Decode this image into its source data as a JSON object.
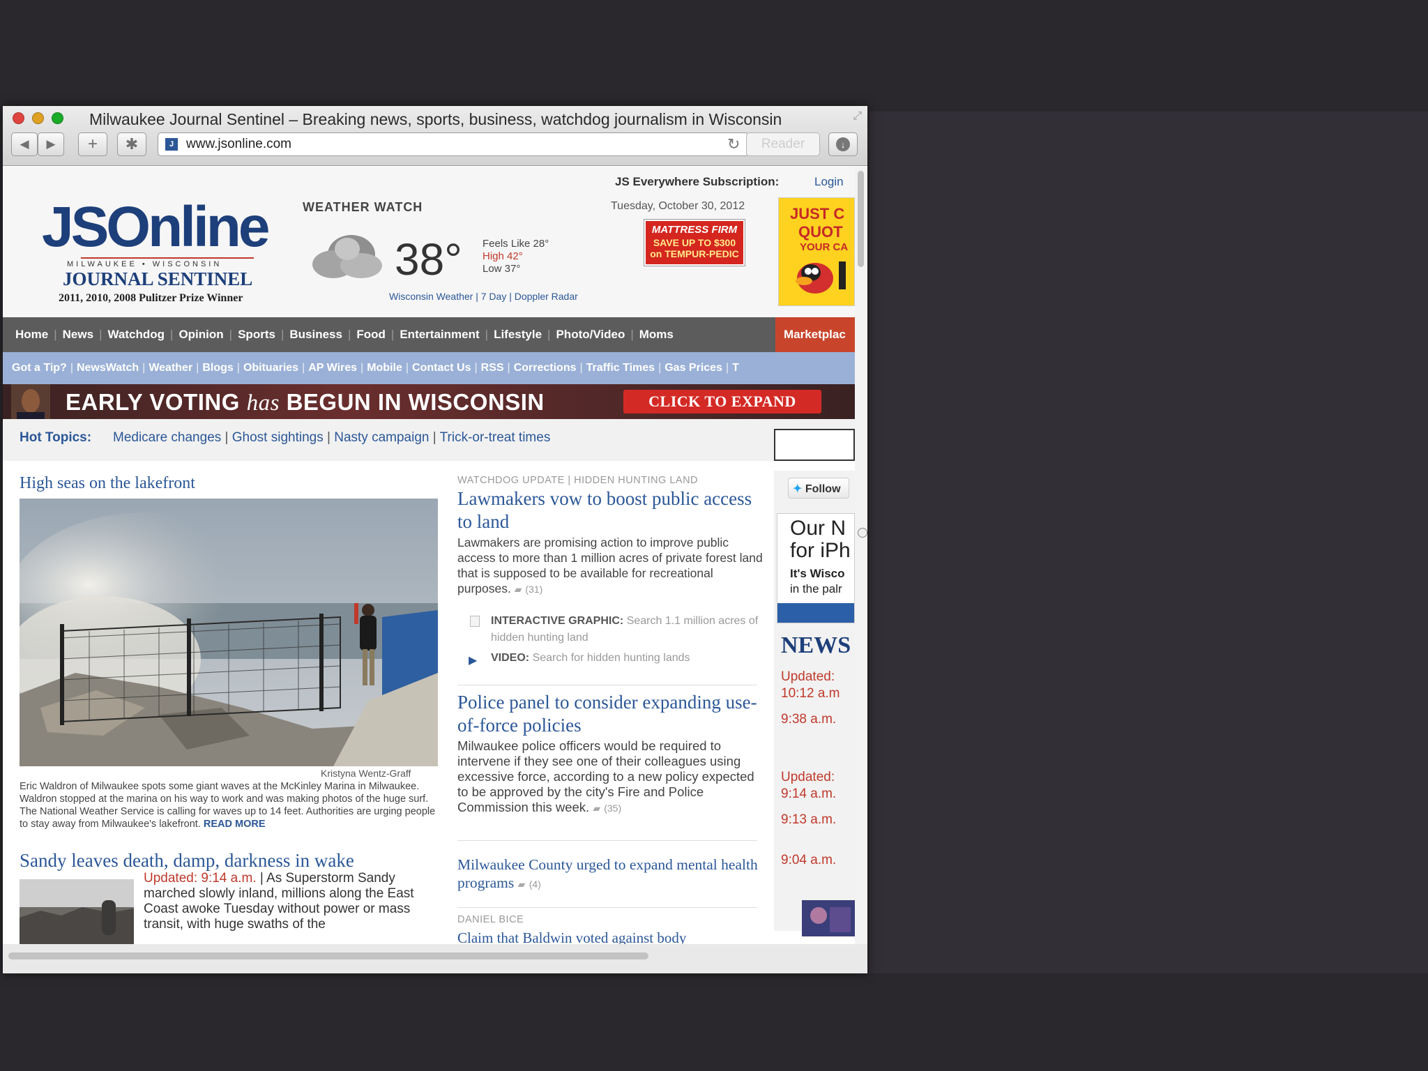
{
  "window": {
    "title": "Milwaukee Journal Sentinel – Breaking news, sports, business, watchdog journalism in Wisconsin",
    "url": "www.jsonline.com",
    "reader_label": "Reader"
  },
  "site": {
    "subscription_label": "JS Everywhere Subscription:",
    "login_label": "Login",
    "logo_main": "JSOnline",
    "logo_sub": "MILWAUKEE • WISCONSIN",
    "logo_paper": "JOURNAL SENTINEL",
    "pulitzer": "2011, 2010, 2008 Pulitzer Prize Winner",
    "date": "Tuesday, October 30, 2012"
  },
  "weather": {
    "heading": "WEATHER WATCH",
    "temp": "38°",
    "feels_like": "Feels Like 28°",
    "high": "High 42°",
    "low": "Low 37°",
    "links": "Wisconsin Weather | 7 Day | Doppler Radar"
  },
  "ads": {
    "mattress_brand": "MATTRESS FIRM",
    "mattress_line1": "SAVE UP TO $300",
    "mattress_line2": "on TEMPUR-PEDIC",
    "side_line1": "JUST C",
    "side_line2": "QUOT",
    "side_line3": "YOUR CA",
    "iphone_line1": "Our N",
    "iphone_line2": "for iPh",
    "iphone_line3": "It's Wisco",
    "iphone_line4": "in the palr"
  },
  "nav": {
    "items": [
      "Home",
      "News",
      "Watchdog",
      "Opinion",
      "Sports",
      "Business",
      "Food",
      "Entertainment",
      "Lifestyle",
      "Photo/Video",
      "Moms"
    ],
    "marketplace": "Marketplac"
  },
  "subnav": {
    "items": [
      "Got a Tip?",
      "NewsWatch",
      "Weather",
      "Blogs",
      "Obituaries",
      "AP Wires",
      "Mobile",
      "Contact Us",
      "RSS",
      "Corrections",
      "Traffic Times",
      "Gas Prices",
      "T"
    ]
  },
  "banner": {
    "text_a": "EARLY VOTING ",
    "text_has": "has",
    "text_b": " BEGUN IN WISCONSIN",
    "cta": "CLICK TO EXPAND"
  },
  "hot_topics": {
    "label": "Hot Topics:",
    "items": [
      "Medicare changes",
      "Ghost sightings",
      "Nasty campaign",
      "Trick-or-treat times"
    ]
  },
  "lead": {
    "heading": "High seas on the lakefront",
    "credit": "Kristyna Wentz-Graff",
    "caption": "Eric Waldron of Milwaukee spots some giant waves at the McKinley Marina in Milwaukee. Waldron stopped at the marina on his way to work and was making photos of the huge surf. The National Weather Service is calling for waves up to 14 feet. Authorities are urging people to stay away from Milwaukee's lakefront.",
    "read_more": "READ MORE"
  },
  "story2": {
    "headline": "Sandy leaves death, damp, darkness in wake",
    "updated": "Updated: 9:14 a.m.",
    "body": " | As Superstorm Sandy marched slowly inland, millions along the East Coast awoke Tuesday without power or mass transit, with huge swaths of the"
  },
  "middle": {
    "kicker": "WATCHDOG UPDATE | HIDDEN HUNTING LAND",
    "s1_headline": "Lawmakers vow to boost public access to land",
    "s1_body": "Lawmakers are promising action to improve public access to more than 1 million acres of private forest land that is supposed to be available for recreational purposes.",
    "s1_comments": "(31)",
    "graphic_label": "INTERACTIVE GRAPHIC:",
    "graphic_text": "Search 1.1 million acres of hidden hunting land",
    "video_label": "VIDEO:",
    "video_text": "Search for hidden hunting lands",
    "s2_headline": "Police panel to consider expanding use-of-force policies",
    "s2_body": "Milwaukee police officers would be required to intervene if they see one of their colleagues using excessive force, according to a new policy expected to be approved by the city's Fire and Police Commission this week.",
    "s2_comments": "(35)",
    "s3_headline": "Milwaukee County urged to expand mental health programs",
    "s3_comments": "(4)",
    "s4_kicker": "DANIEL BICE",
    "s4_headline": "Claim that Baldwin voted against body"
  },
  "right": {
    "follow": "Follow",
    "news_heading": "NEWS",
    "updates": [
      {
        "label": "Updated:",
        "time": "10:12 a.m"
      },
      {
        "label": "",
        "time": "9:38 a.m."
      },
      {
        "label": "Updated:",
        "time": "9:14 a.m."
      },
      {
        "label": "",
        "time": "9:13 a.m."
      },
      {
        "label": "",
        "time": "9:04 a.m."
      }
    ]
  },
  "colors": {
    "link_blue": "#2b5797",
    "nav_bg": "#5c5c5c",
    "subnav_bg": "#9ab0d6",
    "marketplace": "#c8452c",
    "alert_red": "#c0392b"
  },
  "icons": [
    "back-icon",
    "forward-icon",
    "plus-icon",
    "bookmarks-icon",
    "reload-icon",
    "download-icon",
    "cloud-icon",
    "comment-icon",
    "twitter-icon",
    "video-icon"
  ]
}
